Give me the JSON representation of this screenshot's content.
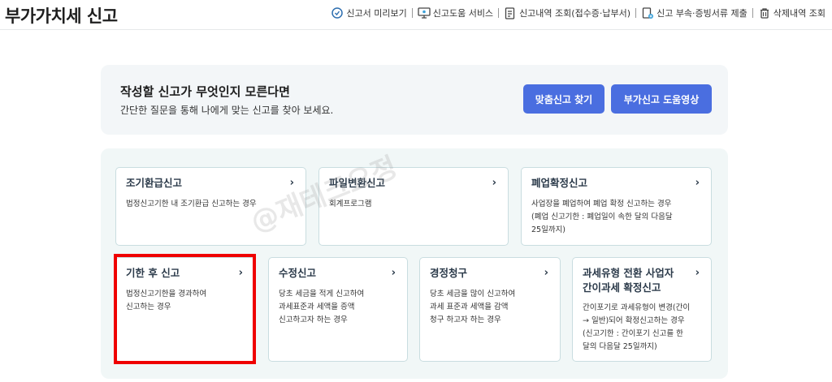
{
  "header": {
    "title": "부가가치세 신고",
    "links": [
      {
        "label": "신고서 미리보기",
        "icon": "magnifier-doc-icon"
      },
      {
        "label": "신고도움 서비스",
        "icon": "monitor-icon"
      },
      {
        "label": "신고내역 조회(접수증·납부서)",
        "icon": "document-list-icon"
      },
      {
        "label": "신고 부속·증빙서류 제출",
        "icon": "document-upload-icon"
      },
      {
        "label": "삭제내역 조회",
        "icon": "trash-icon"
      }
    ]
  },
  "banner": {
    "title": "작성할 신고가 무엇인지 모른다면",
    "description": "간단한 질문을 통해 나에게 맞는 신고를 찾아 보세요.",
    "button_find": "맞춤신고 찾기",
    "button_video": "부가신고 도움영상"
  },
  "cards": [
    {
      "title": "조기환급신고",
      "desc_lines": [
        "법정신고기한 내 조기환급 신고하는 경우"
      ]
    },
    {
      "title": "파일변환신고",
      "desc_lines": [
        "회계프로그램"
      ]
    },
    {
      "title": "폐업확정신고",
      "desc_lines": [
        "사업장을 폐업하여 폐업 확정 신고하는 경우",
        "(폐업 신고기한 : 폐업일이 속한 달의 다음달",
        "25일까지)"
      ]
    },
    {
      "title": "기한 후 신고",
      "desc_lines": [
        "법정신고기한을 경과하여",
        "신고하는 경우"
      ]
    },
    {
      "title": "수정신고",
      "desc_lines": [
        "당초 세금을 적게 신고하여",
        "과세표준과 세액을 증액",
        "신고하고자 하는 경우"
      ]
    },
    {
      "title": "경정청구",
      "desc_lines": [
        "당초 세금을 많이 신고하여",
        "과세 표준과 세액을 감액",
        "청구 하고자 하는 경우"
      ]
    },
    {
      "title_lines": [
        "과세유형 전환 사업자",
        "간이과세 확정신고"
      ],
      "desc_lines": [
        "간이포기로 과세유형이 변경(간이",
        "→ 일반)되어 확정신고하는 경우",
        "(신고기한 : 간이포기 신고를 한",
        "달의 다음달 25일까지)"
      ]
    }
  ],
  "chevron": "›",
  "watermark": "@재테크요정"
}
